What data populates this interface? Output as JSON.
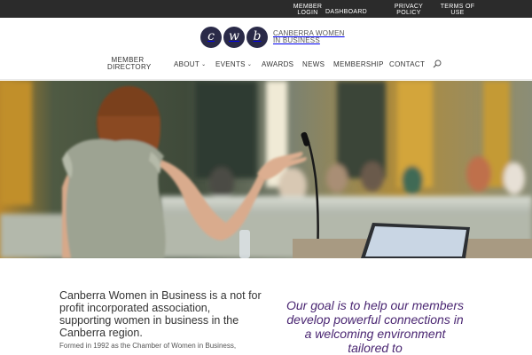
{
  "topbar": {
    "member_login": "MEMBER LOGIN",
    "dashboard": "DASHBOARD",
    "privacy_policy": "PRIVACY POLICY",
    "terms_of_use": "TERMS OF USE"
  },
  "logo": {
    "marks": [
      "c",
      "w",
      "b"
    ],
    "line1": "CANBERRA WOMEN",
    "line2": "IN BUSINESS"
  },
  "nav": {
    "member_directory": "MEMBER DIRECTORY",
    "about": "ABOUT",
    "events": "EVENTS",
    "awards": "AWARDS",
    "news": "NEWS",
    "membership": "MEMBERSHIP",
    "contact": "CONTACT",
    "search_icon": "search-icon",
    "chevron_icon": "chevron-down-icon"
  },
  "hero": {
    "image": "woman presenting at conference with microphone and laptop"
  },
  "content": {
    "intro": "Canberra Women in Business is a not for profit incorporated association, supporting women in business in the Canberra region.",
    "formed": "Formed in 1992 as the Chamber of Women in Business,",
    "goal": "Our goal is to help our members develop powerful connections in a welcoming environment tailored to"
  },
  "colors": {
    "topbar_bg": "#2b2b2b",
    "logo_mark": "#2a2a48",
    "goal_text": "#4a2672"
  }
}
